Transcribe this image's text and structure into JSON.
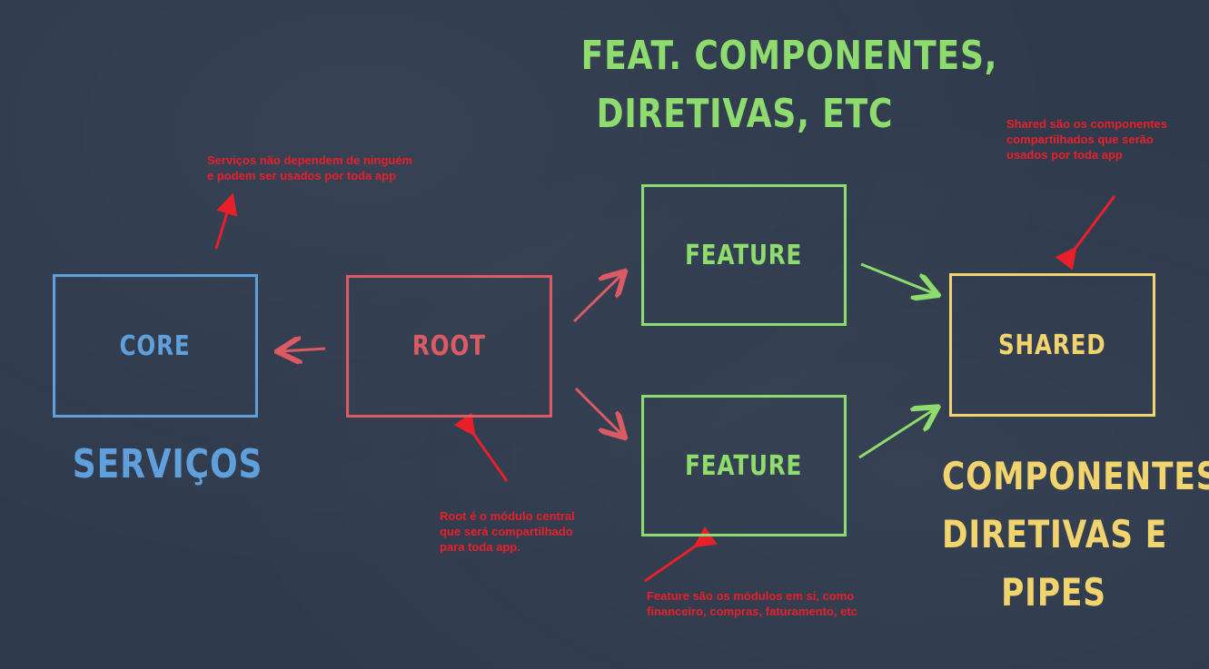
{
  "modules": {
    "core": "CORE",
    "root": "ROOT",
    "feature_top": "FEATURE",
    "feature_bottom": "FEATURE",
    "shared": "SHARED"
  },
  "headings": {
    "feature": [
      "FEAT. COMPONENTES,",
      "DIRETIVAS, ETC"
    ],
    "core": "SERVIÇOS",
    "shared": [
      "COMPONENTES,",
      "DIRETIVAS E",
      "PIPES"
    ]
  },
  "notes": {
    "core": [
      "Serviços não dependem de ninguém",
      "e podem ser usados por toda app"
    ],
    "root": [
      "Root é o módulo central",
      "que será compartilhado",
      "para toda app."
    ],
    "feature": [
      "Feature são os módulos em si, como",
      "financeiro, compras, faturamento, etc"
    ],
    "shared": [
      "Shared são os componentes",
      "compartilhados que serão",
      "usados por toda app"
    ]
  },
  "colors": {
    "background": "#2f3b4d",
    "core": "#5f9fdc",
    "root": "#dc5a64",
    "feature": "#8fdc6e",
    "shared": "#f2d46e",
    "annotation": "#e8202a"
  }
}
